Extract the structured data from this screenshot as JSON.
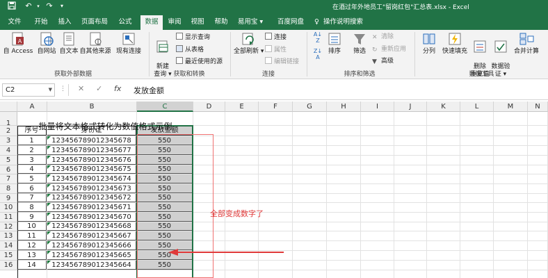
{
  "title_bar": {
    "title": "在酒过年外地员工\"留岗红包\"汇总表.xlsx - Excel"
  },
  "tabs": [
    {
      "label": "文件",
      "active": false
    },
    {
      "label": "开始",
      "active": false
    },
    {
      "label": "插入",
      "active": false
    },
    {
      "label": "页面布局",
      "active": false
    },
    {
      "label": "公式",
      "active": false
    },
    {
      "label": "数据",
      "active": true
    },
    {
      "label": "审阅",
      "active": false
    },
    {
      "label": "视图",
      "active": false
    },
    {
      "label": "帮助",
      "active": false
    },
    {
      "label": "易用宝 ▾",
      "active": false
    },
    {
      "label": "百度网盘",
      "active": false
    }
  ],
  "tell_me": "操作说明搜索",
  "ribbon": {
    "groups": [
      {
        "label": "获取外部数据"
      },
      {
        "label": "获取和转换"
      },
      {
        "label": "连接"
      },
      {
        "label": "排序和筛选"
      },
      {
        "label": "数据工具"
      }
    ],
    "ext_data": [
      "自 Access",
      "自网站",
      "自文本",
      "自其他来源",
      "现有连接"
    ],
    "get_transform": {
      "new_query": "新建\n查询 ▾",
      "show_queries": "显示查询",
      "from_table": "从表格",
      "recent_sources": "最近使用的源"
    },
    "connections": {
      "refresh_all": "全部刷新 ▾",
      "connections": "连接",
      "properties": "属性",
      "edit_links": "编辑链接"
    },
    "sort_filter": {
      "sort": "排序",
      "filter": "筛选",
      "clear": "清除",
      "reapply": "重新应用",
      "advanced": "高级"
    },
    "data_tools": [
      "分列",
      "快速填充",
      "删除\n重复值",
      "数据验\n证 ▾",
      "合并计算"
    ]
  },
  "formula_bar": {
    "name_box": "C2",
    "cancel": "✕",
    "enter": "✓",
    "fx": "fx",
    "formula": "发放金额"
  },
  "sheet": {
    "columns": [
      "A",
      "B",
      "C",
      "D",
      "E",
      "F",
      "G",
      "H",
      "I",
      "J",
      "K",
      "L",
      "M",
      "N"
    ],
    "selected_column": "C",
    "title": "批量将文本格式转化为数值格式示例",
    "headers": [
      "序号",
      "身份证",
      "发放金额"
    ],
    "rows": [
      [
        "1",
        "123456789012345678",
        "550"
      ],
      [
        "2",
        "123456789012345677",
        "550"
      ],
      [
        "3",
        "123456789012345676",
        "550"
      ],
      [
        "4",
        "123456789012345675",
        "550"
      ],
      [
        "5",
        "123456789012345674",
        "550"
      ],
      [
        "6",
        "123456789012345673",
        "550"
      ],
      [
        "7",
        "123456789012345672",
        "550"
      ],
      [
        "8",
        "123456789012345671",
        "550"
      ],
      [
        "9",
        "123456789012345670",
        "550"
      ],
      [
        "10",
        "123456789012345668",
        "550"
      ],
      [
        "11",
        "123456789012345667",
        "550"
      ],
      [
        "12",
        "123456789012345666",
        "550"
      ],
      [
        "13",
        "123456789012345665",
        "550"
      ],
      [
        "14",
        "123456789012345664",
        "550"
      ]
    ],
    "row_numbers": [
      "1",
      "2",
      "3",
      "4",
      "5",
      "6",
      "7",
      "8",
      "9",
      "10",
      "11",
      "12",
      "13",
      "14",
      "15",
      "16"
    ],
    "annotation": "全部变成数字了"
  },
  "colors": {
    "excel_green": "#217346",
    "annotation_red": "#e03a3a",
    "selection_gray": "#d0d0d0"
  }
}
